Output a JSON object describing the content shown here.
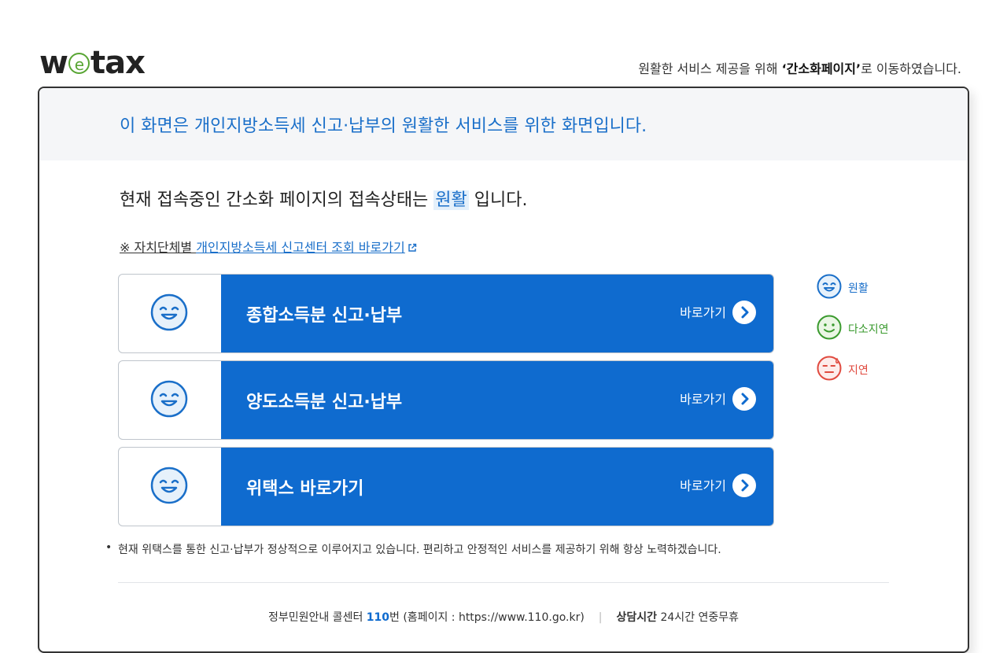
{
  "header": {
    "logo_left": "w",
    "logo_e": "e",
    "logo_right": "tax",
    "notice_prefix": "원활한 서비스 제공을 위해 ",
    "notice_bold": "‘간소화페이지’",
    "notice_suffix": "로 이동하였습니다."
  },
  "banner": {
    "text": "이 화면은 개인지방소득세 신고·납부의 원활한 서비스를 위한 화면입니다."
  },
  "status": {
    "prefix": "현재 접속중인 간소화 페이지의 접속상태는 ",
    "value": "원활",
    "suffix": " 입니다."
  },
  "link_line": {
    "prefix": "※ 자치단체별 ",
    "link": "개인지방소득세 신고센터 조회 바로가기"
  },
  "services": [
    {
      "title": "종합소득분 신고·납부",
      "go_label": "바로가기"
    },
    {
      "title": "양도소득분 신고·납부",
      "go_label": "바로가기"
    },
    {
      "title": "위택스 바로가기",
      "go_label": "바로가기"
    }
  ],
  "legend": [
    {
      "label": "원활",
      "color": "#1a6fc9"
    },
    {
      "label": "다소지연",
      "color": "#3a9a2e"
    },
    {
      "label": "지연",
      "color": "#e04a3f"
    }
  ],
  "note": "현재 위택스를 통한 신고·납부가 정상적으로 이루어지고 있습니다. 편리하고 안정적인 서비스를 제공하기 위해 항상 노력하겠습니다.",
  "footer": {
    "center_label": "정부민원안내 콜센터 ",
    "number": "110",
    "center_suffix": "번 (홈페이지 : https://www.110.go.kr)",
    "hours_label": "상담시간",
    "hours_value": " 24시간 연중무휴"
  },
  "colors": {
    "accent": "#0f6bcf",
    "logo_green": "#58a533"
  },
  "icons": {
    "face": "smile-face-icon",
    "arrow": "chevron-right-icon",
    "external": "external-link-icon"
  }
}
